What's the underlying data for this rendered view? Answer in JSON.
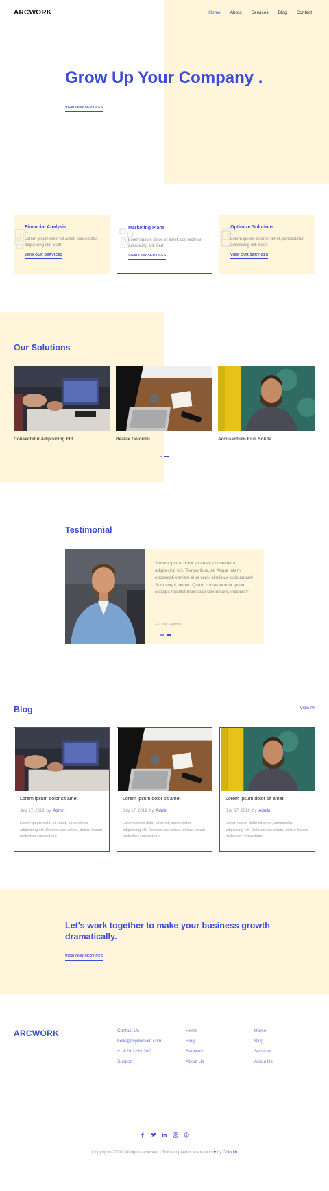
{
  "header": {
    "logo": "ARCWORK",
    "nav": [
      "Home",
      "About",
      "Services",
      "Blog",
      "Contact"
    ]
  },
  "hero": {
    "title": "Grow Up Your Company .",
    "link": "VIEW OUR SERVICES"
  },
  "services": [
    {
      "title": "Financial Analysis",
      "desc": "Lorem ipsum dolor sit amet, consectetur adipisicing elit. Sed!",
      "link": "VIEW OUR SERVICES",
      "icon": "financial-chart-icon"
    },
    {
      "title": "Marketing Plans",
      "desc": "Lorem ipsum dolor sit amet, consectetur adipisicing elit. Sed!",
      "link": "VIEW OUR SERVICES",
      "icon": "marketing-gears-icon"
    },
    {
      "title": "Optimize Solutions",
      "desc": "Lorem ipsum dolor sit amet, consectetur adipisicing elit. Sed!",
      "link": "VIEW OUR SERVICES",
      "icon": "optimize-puzzle-icon"
    }
  ],
  "solutions": {
    "title": "Our Solutions",
    "items": [
      {
        "caption": "Consectetur Adipisicing Elit"
      },
      {
        "caption": "Beatae Doloribu"
      },
      {
        "caption": "Accusantium Eius Soluta"
      }
    ]
  },
  "testimonial": {
    "title": "Testimonial",
    "quote": "“Lorem ipsum dolor sit amet, consectetur adipisicing elit. Temporibus, at! Atque totam obcaecati veniam eius vero, similique quibusdam! Sunt sequi, nemo. Quam consequuntur ipsum suscipit repellat molestiae laborosam, incidunt!”",
    "author": "— Craig Stephen"
  },
  "blog": {
    "title": "Blog",
    "view_all": "View All",
    "posts": [
      {
        "title": "Lorem ipsum dolor sit amet",
        "date": "July 17, 2019",
        "by": "by",
        "author": "Admin",
        "excerpt": "Lorem ipsum dolor sit amet, consectetur adipisicing elit. Dolores eos soluta, dolore harum molestias consectetur."
      },
      {
        "title": "Lorem ipsum dolor sit amet",
        "date": "July 17, 2019",
        "by": "by",
        "author": "Admin",
        "excerpt": "Lorem ipsum dolor sit amet, consectetur adipisicing elit. Dolores eos soluta, dolore harum molestias consectetur."
      },
      {
        "title": "Lorem ipsum dolor sit amet",
        "date": "July 17, 2019",
        "by": "by",
        "author": "Admin",
        "excerpt": "Lorem ipsum dolor sit amet, consectetur adipisicing elit. Dolores eos soluta, dolore harum molestias consectetur."
      }
    ]
  },
  "cta": {
    "title": "Let's work together to make your business growth dramatically.",
    "link": "VIEW OUR SERVICES"
  },
  "footer": {
    "logo": "ARCWORK",
    "col1": [
      "Contact Us",
      "hello@mydomain.com",
      "+1 829 2293 382",
      "Support"
    ],
    "col2": [
      "Home",
      "Blog",
      "Services",
      "About Us"
    ],
    "col3": [
      "Home",
      "Blog",
      "Services",
      "About Us"
    ],
    "socials": [
      "facebook-icon",
      "twitter-icon",
      "linkedin-icon",
      "instagram-icon",
      "skype-icon"
    ],
    "copyright_prefix": "Copyright ©2020 All rights reserved | This template is made with",
    "heart": "♥",
    "copyright_by": "by",
    "copyright_brand": "Colorlib"
  },
  "colors": {
    "accent": "#3b4bd8",
    "cream": "#fff5db"
  }
}
